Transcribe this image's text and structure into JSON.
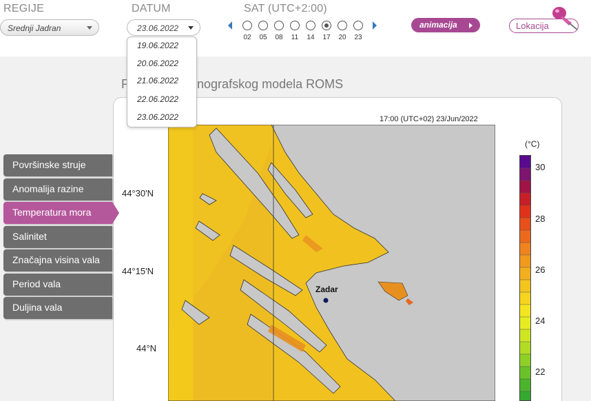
{
  "header": {
    "region_label": "REGIJE",
    "region_value": "Srednji Jadran",
    "date_label": "DATUM",
    "date_value": "23.06.2022",
    "date_options": [
      "19.06.2022",
      "20.06.2022",
      "21.06.2022",
      "22.06.2022",
      "23.06.2022"
    ],
    "time_label": "SAT (UTC+2:00)",
    "hours": [
      "02",
      "05",
      "08",
      "11",
      "14",
      "17",
      "20",
      "23"
    ],
    "selected_hour": "17",
    "animation_label": "animacija",
    "location_label": "Lokacija"
  },
  "page": {
    "title_visible": "P",
    "title_visible_rest": "anografskog modela ROMS"
  },
  "sidebar": {
    "items": [
      {
        "label": "Površinske struje",
        "active": false
      },
      {
        "label": "Anomalija razine",
        "active": false
      },
      {
        "label": "Temperatura mora",
        "active": true
      },
      {
        "label": "Salinitet",
        "active": false
      },
      {
        "label": "Značajna visina vala",
        "active": false
      },
      {
        "label": "Period vala",
        "active": false
      },
      {
        "label": "Duljina vala",
        "active": false
      }
    ]
  },
  "map": {
    "timestamp": "17:00 (UTC+02)  23/Jun/2022",
    "city_label": "Zadar",
    "lat_labels": [
      "44°30'N",
      "44°15'N",
      "44°N"
    ],
    "colorbar_unit": "(°C)",
    "colorbar_ticks": [
      "30",
      "28",
      "26",
      "24",
      "22"
    ]
  },
  "colors": {
    "accent": "#b5579b",
    "menu_bg": "#6e6e6e",
    "land": "#c8c8c8",
    "sea_warm": "#f1c21f",
    "sea_hot": "#e8901f"
  }
}
